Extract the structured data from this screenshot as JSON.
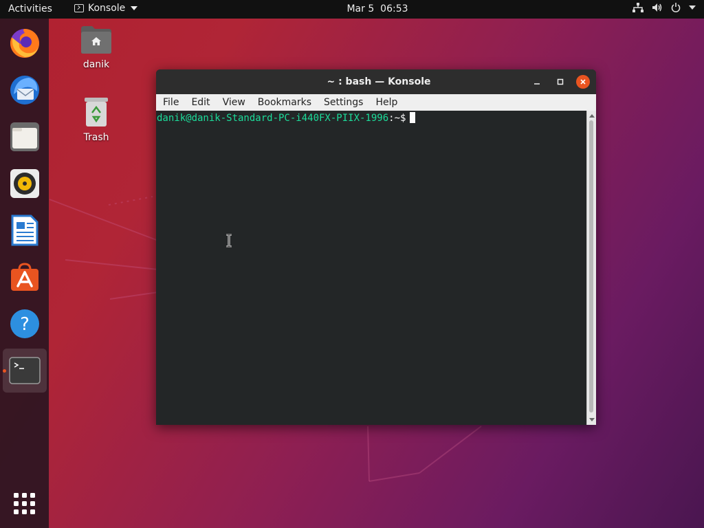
{
  "topbar": {
    "activities": "Activities",
    "app_name": "Konsole",
    "clock_date": "Mar 5",
    "clock_time": "06:53",
    "tray_icons": [
      "network-icon",
      "volume-icon",
      "power-icon",
      "system-menu-caret-icon"
    ]
  },
  "dock": {
    "items": [
      {
        "name": "Firefox",
        "icon": "firefox-icon"
      },
      {
        "name": "Thunderbird",
        "icon": "thunderbird-icon"
      },
      {
        "name": "Files",
        "icon": "files-icon"
      },
      {
        "name": "Rhythmbox",
        "icon": "rhythmbox-icon"
      },
      {
        "name": "LibreOffice Writer",
        "icon": "writer-icon"
      },
      {
        "name": "Ubuntu Software",
        "icon": "software-icon"
      },
      {
        "name": "Help",
        "icon": "help-icon"
      },
      {
        "name": "Terminal",
        "icon": "terminal-icon",
        "active": true
      }
    ],
    "app_grid_icon": "show-applications-icon"
  },
  "desktop_icons": {
    "home": {
      "label": "danik",
      "icon": "home-folder-icon"
    },
    "trash": {
      "label": "Trash",
      "icon": "trash-icon"
    }
  },
  "window": {
    "title": "~ : bash — Konsole",
    "menu": [
      "File",
      "Edit",
      "View",
      "Bookmarks",
      "Settings",
      "Help"
    ],
    "terminal": {
      "prompt_user": "danik@danik-Standard-PC-i440FX-PIIX-1996",
      "prompt_path": ":~$"
    }
  },
  "colors": {
    "accent": "#e95420",
    "prompt_green": "#1cdc9a",
    "terminal_bg": "#232627"
  }
}
